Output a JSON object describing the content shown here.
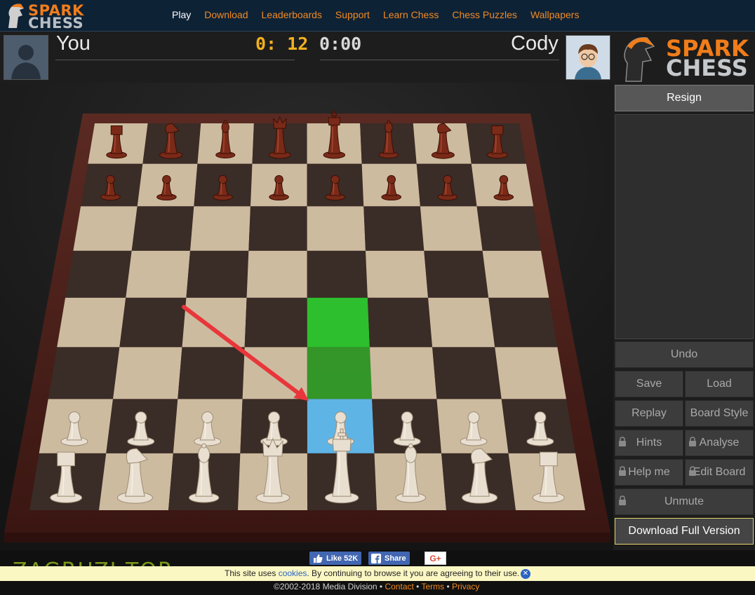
{
  "nav": {
    "brand_line1": "SPARK",
    "brand_line2": "CHESS",
    "links": [
      "Play",
      "Download",
      "Leaderboards",
      "Support",
      "Learn Chess",
      "Chess Puzzles",
      "Wallpapers"
    ]
  },
  "players": {
    "you": {
      "name": "You",
      "clock": "0: 12"
    },
    "opponent": {
      "name": "Cody",
      "clock": "0:00"
    }
  },
  "logo": {
    "line1": "SPARK",
    "line2": "CHESS"
  },
  "board": {
    "highlight_from_color": "#2dbf2d",
    "selected_square_color": "#5fb4e6",
    "arrow_color": "#e8363a",
    "ranks_top_to_bottom": [
      [
        "black-rook",
        "black-knight",
        "black-bishop",
        "black-queen",
        "black-king",
        "black-bishop",
        "black-knight",
        "black-rook"
      ],
      [
        "black-pawn",
        "black-pawn",
        "black-pawn",
        "black-pawn",
        "black-pawn",
        "black-pawn",
        "black-pawn",
        "black-pawn"
      ],
      [
        "",
        "",
        "",
        "",
        "",
        "",
        "",
        ""
      ],
      [
        "",
        "",
        "",
        "",
        "",
        "",
        "",
        ""
      ],
      [
        "",
        "",
        "",
        "",
        "",
        "",
        "",
        ""
      ],
      [
        "",
        "",
        "",
        "",
        "",
        "",
        "",
        ""
      ],
      [
        "white-pawn",
        "white-pawn",
        "white-pawn",
        "white-pawn",
        "white-pawn",
        "white-pawn",
        "white-pawn",
        "white-pawn"
      ],
      [
        "white-rook",
        "white-knight",
        "white-bishop",
        "white-queen",
        "white-king",
        "white-bishop",
        "white-knight",
        "white-rook"
      ]
    ]
  },
  "side": {
    "resign": "Resign",
    "undo": "Undo",
    "save": "Save",
    "load": "Load",
    "replay": "Replay",
    "board_style": "Board Style",
    "hints": "Hints",
    "analyse": "Analyse",
    "help_me": "Help me",
    "edit_board": "Edit Board",
    "unmute": "Unmute",
    "download_full": "Download Full Version"
  },
  "footer": {
    "fb_like": "Like 52K",
    "fb_share": "Share",
    "gplus": "G+",
    "watermark": "ZAGRUZI.TOP",
    "cookie_pre": "This site uses ",
    "cookie_link": "cookies",
    "cookie_post": ". By continuing to browse it you are agreeing to their use.",
    "copyright": "©2002-2018 Media Division",
    "contact": "Contact",
    "terms": "Terms",
    "privacy": "Privacy"
  }
}
